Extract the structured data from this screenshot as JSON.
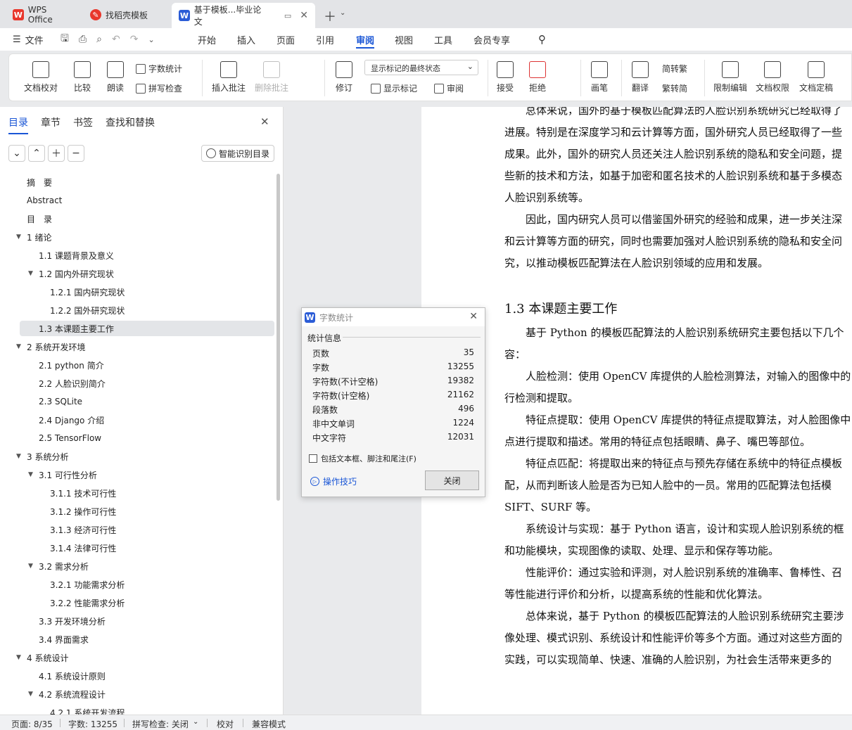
{
  "tabs": [
    {
      "label": "WPS Office"
    },
    {
      "label": "找稻壳模板"
    },
    {
      "label": "基于模板...毕业论文"
    }
  ],
  "menu": {
    "file_label": "文件",
    "items": [
      "开始",
      "插入",
      "页面",
      "引用",
      "审阅",
      "视图",
      "工具",
      "会员专享"
    ],
    "active_item": "审阅"
  },
  "ribbon": {
    "doc_check": "文档校对",
    "compare": "比较",
    "read_aloud": "朗读",
    "word_count": "字数统计",
    "spell_check": "拼写检查",
    "insert_comment": "插入批注",
    "delete_comment": "删除批注",
    "track_changes": "修订",
    "display_state": "显示标记的最终状态",
    "show_markup": "显示标记",
    "review": "审阅",
    "accept": "接受",
    "reject": "拒绝",
    "pen": "画笔",
    "translate": "翻译",
    "to_traditional": "简转繁",
    "to_simplified": "繁转简",
    "restrict_edit": "限制编辑",
    "doc_permission": "文档权限",
    "doc_finalize": "文档定稿"
  },
  "sidebar": {
    "tabs": [
      "目录",
      "章节",
      "书签",
      "查找和替换"
    ],
    "smart_toc": "智能识别目录",
    "toc": [
      {
        "label": "摘　要",
        "level": 1,
        "arrow": false
      },
      {
        "label": "Abstract",
        "level": 1,
        "arrow": false
      },
      {
        "label": "目　录",
        "level": 1,
        "arrow": false
      },
      {
        "label": "1  绪论",
        "level": 1,
        "arrow": true
      },
      {
        "label": "1.1 课题背景及意义",
        "level": 2,
        "arrow": false
      },
      {
        "label": "1.2  国内外研究现状",
        "level": 2,
        "arrow": true
      },
      {
        "label": "1.2.1 国内研究现状",
        "level": 3,
        "arrow": false
      },
      {
        "label": "1.2.2 国外研究现状",
        "level": 3,
        "arrow": false
      },
      {
        "label": "1.3  本课题主要工作",
        "level": 2,
        "arrow": false,
        "selected": true
      },
      {
        "label": "2  系统开发环境",
        "level": 1,
        "arrow": true
      },
      {
        "label": "2.1 python 简介",
        "level": 2,
        "arrow": false
      },
      {
        "label": "2.2  人脸识别简介",
        "level": 2,
        "arrow": false
      },
      {
        "label": "2.3 SQLite",
        "level": 2,
        "arrow": false
      },
      {
        "label": "2.4 Django 介绍",
        "level": 2,
        "arrow": false
      },
      {
        "label": "2.5 TensorFlow",
        "level": 2,
        "arrow": false
      },
      {
        "label": "3  系统分析",
        "level": 1,
        "arrow": true
      },
      {
        "label": "3.1  可行性分析",
        "level": 2,
        "arrow": true
      },
      {
        "label": "3.1.1  技术可行性",
        "level": 3,
        "arrow": false
      },
      {
        "label": "3.1.2 操作可行性",
        "level": 3,
        "arrow": false
      },
      {
        "label": "3.1.3  经济可行性",
        "level": 3,
        "arrow": false
      },
      {
        "label": "3.1.4  法律可行性",
        "level": 3,
        "arrow": false
      },
      {
        "label": "3.2 需求分析",
        "level": 2,
        "arrow": true
      },
      {
        "label": "3.2.1  功能需求分析",
        "level": 3,
        "arrow": false
      },
      {
        "label": "3.2.2  性能需求分析",
        "level": 3,
        "arrow": false
      },
      {
        "label": "3.3 开发环境分析",
        "level": 2,
        "arrow": false
      },
      {
        "label": "3.4 界面需求",
        "level": 2,
        "arrow": false
      },
      {
        "label": "4  系统设计",
        "level": 1,
        "arrow": true
      },
      {
        "label": "4.1 系统设计原则",
        "level": 2,
        "arrow": false
      },
      {
        "label": "4.2 系统流程设计",
        "level": 2,
        "arrow": true
      },
      {
        "label": "4.2.1 系统开发流程",
        "level": 3,
        "arrow": false
      }
    ]
  },
  "document": {
    "lines": [
      "　　总体来说，国外的基于模板匹配算法的人脸识别系统研究已经取得了",
      "进展。特别是在深度学习和云计算等方面，国外研究人员已经取得了一些",
      "成果。此外，国外的研究人员还关注人脸识别系统的隐私和安全问题，提",
      "些新的技术和方法，如基于加密和匿名技术的人脸识别系统和基于多模态",
      "人脸识别系统等。",
      "　　因此，国内研究人员可以借鉴国外研究的经验和成果，进一步关注深",
      "和云计算等方面的研究，同时也需要加强对人脸识别系统的隐私和安全问",
      "究，以推动模板匹配算法在人脸识别领域的应用和发展。"
    ],
    "heading": "1.3  本课题主要工作",
    "lines2": [
      "　　基于 Python 的模板匹配算法的人脸识别系统研究主要包括以下几个",
      "容：",
      "　　人脸检测：使用 OpenCV 库提供的人脸检测算法，对输入的图像中的",
      "行检测和提取。",
      "　　特征点提取：使用 OpenCV 库提供的特征点提取算法，对人脸图像中",
      "点进行提取和描述。常用的特征点包括眼睛、鼻子、嘴巴等部位。",
      "　　特征点匹配：将提取出来的特征点与预先存储在系统中的特征点模板",
      "配，从而判断该人脸是否为已知人脸中的一员。常用的匹配算法包括模",
      "SIFT、SURF 等。",
      "　　系统设计与实现：基于 Python 语言，设计和实现人脸识别系统的框",
      "和功能模块，实现图像的读取、处理、显示和保存等功能。",
      "　　性能评价：通过实验和评测，对人脸识别系统的准确率、鲁棒性、召",
      "等性能进行评价和分析，以提高系统的性能和优化算法。",
      "　　总体来说，基于 Python 的模板匹配算法的人脸识别系统研究主要涉",
      "像处理、模式识别、系统设计和性能评价等多个方面。通过对这些方面的",
      "实践，可以实现简单、快速、准确的人脸识别，为社会生活带来更多的"
    ]
  },
  "dialog": {
    "title": "字数统计",
    "section": "统计信息",
    "rows": [
      {
        "label": "页数",
        "value": "35"
      },
      {
        "label": "字数",
        "value": "13255"
      },
      {
        "label": "字符数(不计空格)",
        "value": "19382"
      },
      {
        "label": "字符数(计空格)",
        "value": "21162"
      },
      {
        "label": "段落数",
        "value": "496"
      },
      {
        "label": "非中文单词",
        "value": "1224"
      },
      {
        "label": "中文字符",
        "value": "12031"
      }
    ],
    "checkbox_label": "包括文本框、脚注和尾注(F)",
    "tips": "操作技巧",
    "close": "关闭"
  },
  "status": {
    "page": "页面: 8/35",
    "words": "字数: 13255",
    "spell": "拼写检查: 关闭",
    "proofread": "校对",
    "compat": "兼容模式"
  },
  "colors": {
    "accent": "#1a56d6",
    "wps_red": "#e8372c",
    "doc_blue": "#2b5cd6"
  }
}
